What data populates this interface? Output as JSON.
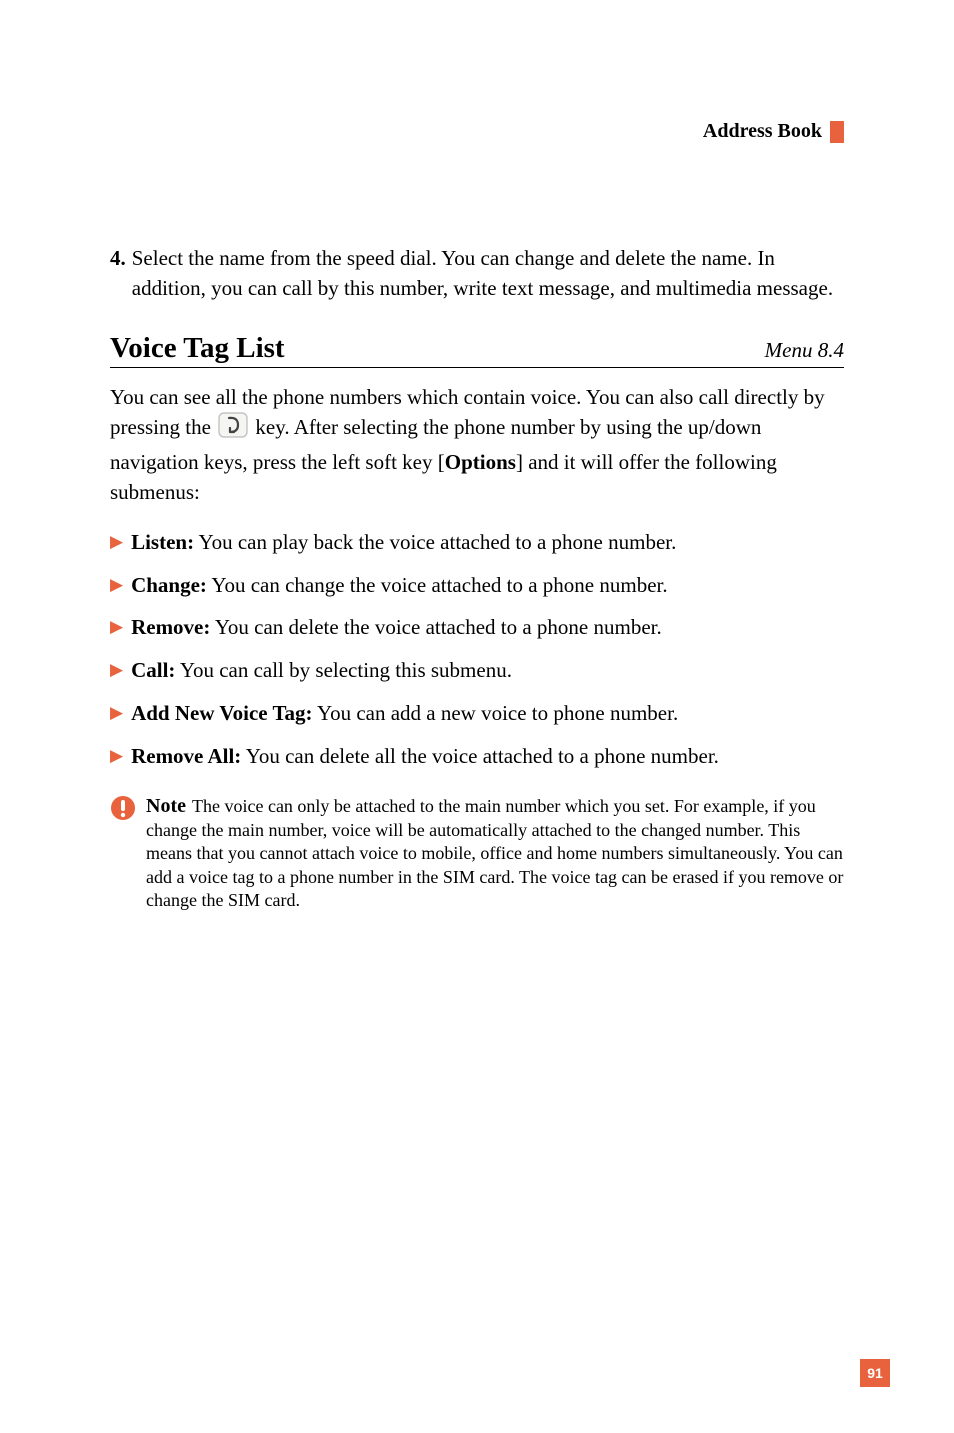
{
  "header": {
    "title": "Address Book"
  },
  "step": {
    "number": "4.",
    "text": "Select the name from the speed dial. You can change and delete the name. In addition, you can call by this number, write text message, and multimedia message."
  },
  "section": {
    "title": "Voice Tag List",
    "menu": "Menu 8.4",
    "intro_before": "You can see all the phone numbers which contain voice. You can also call directly by pressing the ",
    "intro_after_key": " key. After selecting the phone number by using the up/down navigation keys, press the left soft key [",
    "options_word": "Options",
    "intro_after_options": "] and it will offer the following submenus:"
  },
  "bullets": [
    {
      "label": "Listen:",
      "text": " You can play back the voice attached to a phone number."
    },
    {
      "label": "Change:",
      "text": " You can change the voice attached to a phone number."
    },
    {
      "label": "Remove:",
      "text": " You can delete the voice attached to a phone number."
    },
    {
      "label": "Call:",
      "text": " You can call by selecting this submenu."
    },
    {
      "label": "Add New Voice Tag:",
      "text": " You can add a new voice to phone number."
    },
    {
      "label": "Remove All:",
      "text": " You can delete all the voice attached to a phone number."
    }
  ],
  "note": {
    "label": "Note",
    "text": "The voice can only be attached to the main number which you set. For example, if you change the main number, voice will be automatically attached to the changed number. This means that you cannot attach voice to mobile, office and home numbers simultaneously. You can add a voice tag to a phone number in the SIM card. The voice tag can be erased if you remove or change the SIM card."
  },
  "page_number": "91"
}
